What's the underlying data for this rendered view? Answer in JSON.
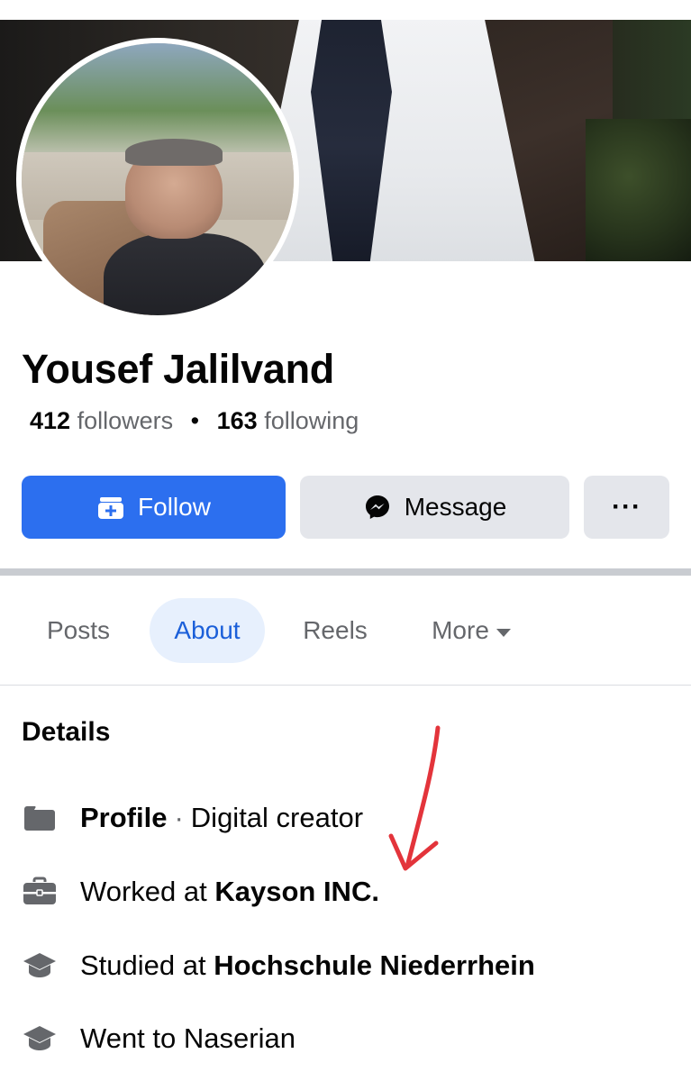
{
  "profile": {
    "name": "Yousef Jalilvand",
    "followers_count": "412",
    "followers_label": "followers",
    "separator": "•",
    "following_count": "163",
    "following_label": "following"
  },
  "actions": {
    "follow_label": "Follow",
    "message_label": "Message",
    "more_label": "···"
  },
  "tabs": [
    {
      "label": "Posts",
      "active": false
    },
    {
      "label": "About",
      "active": true
    },
    {
      "label": "Reels",
      "active": false
    },
    {
      "label": "More",
      "active": false
    }
  ],
  "details": {
    "title": "Details",
    "items": [
      {
        "icon": "profile-icon",
        "bold": "Profile",
        "separator": "·",
        "text": "Digital creator"
      },
      {
        "icon": "briefcase-icon",
        "prefix": "Worked at",
        "bold": "Kayson INC."
      },
      {
        "icon": "graduation-cap-icon",
        "prefix": "Studied at",
        "bold": "Hochschule Niederrhein"
      },
      {
        "icon": "graduation-cap-icon",
        "prefix": "Went to",
        "text": "Naserian"
      }
    ]
  },
  "colors": {
    "accent": "#2c6fef",
    "tab_active_bg": "#e7f0fd",
    "tab_active_text": "#1b5fd9",
    "secondary_button": "#e4e6eb",
    "muted_text": "#65676b",
    "annotation_arrow": "#e3343b"
  }
}
